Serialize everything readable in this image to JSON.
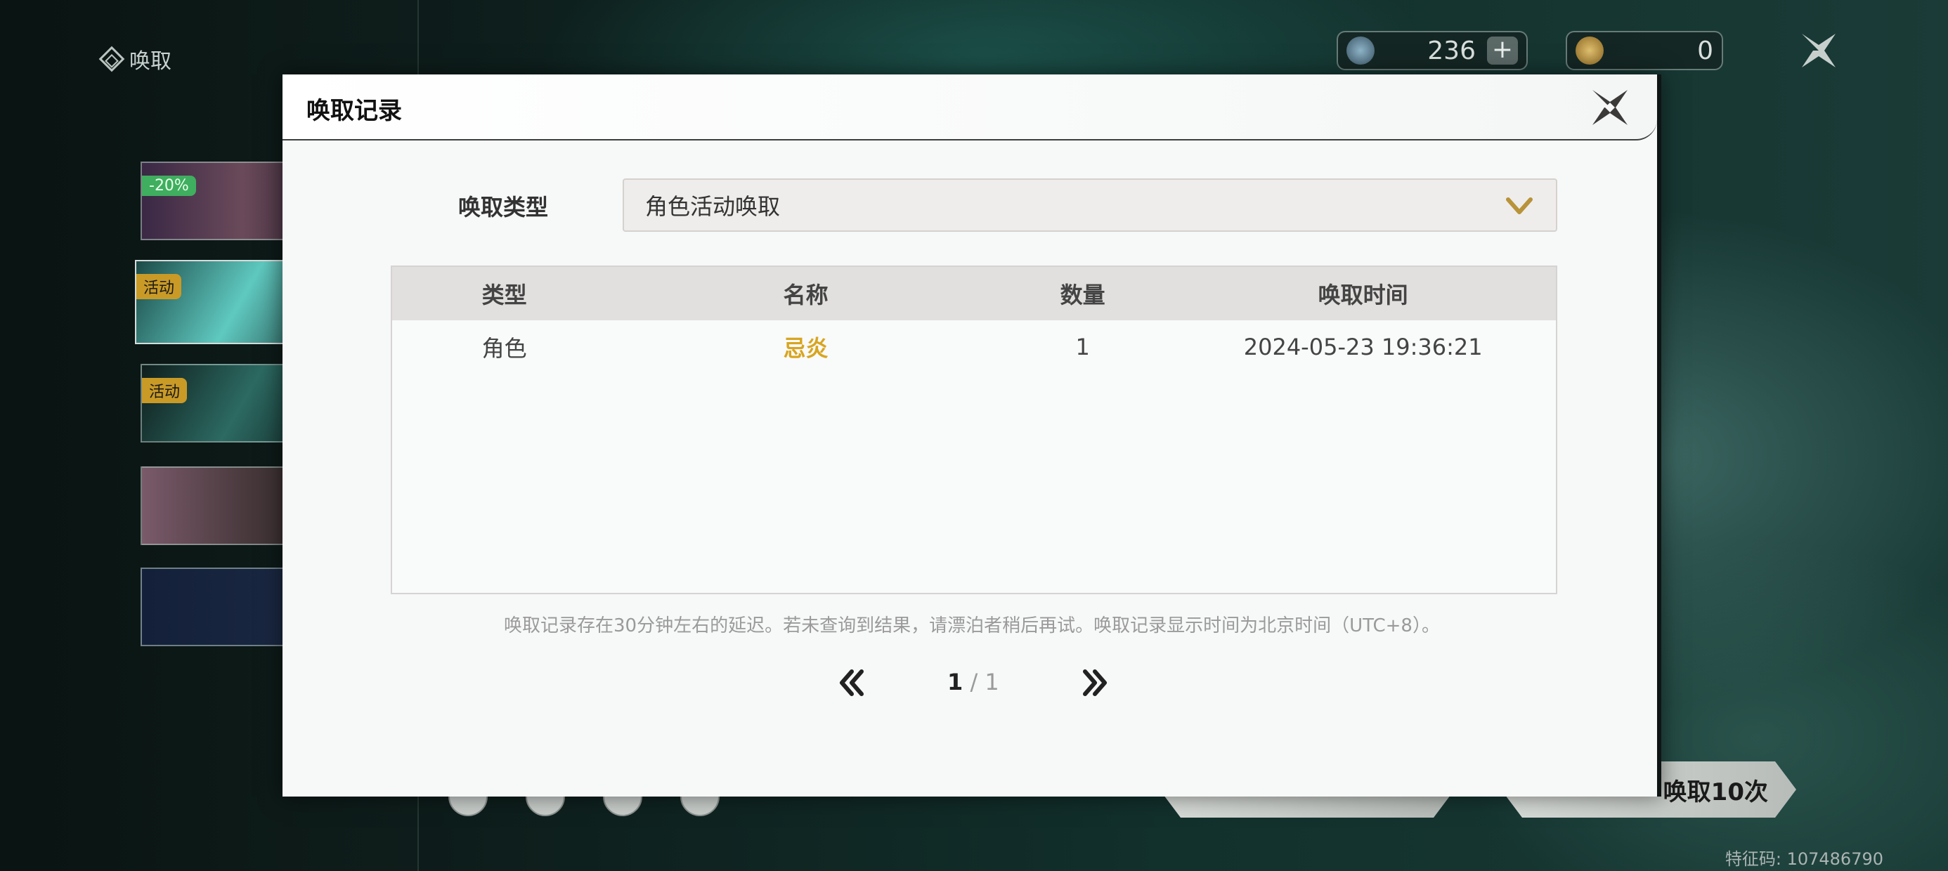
{
  "background": {
    "summon_title": "唤取",
    "resources": [
      {
        "name": "star-currency",
        "value": "236"
      },
      {
        "name": "coin-currency",
        "value": "0"
      }
    ],
    "banner_tags": [
      "-20%",
      "活动",
      "活动"
    ],
    "bottom_button": "唤取10次",
    "feature_code": "特征码: 107486790"
  },
  "modal": {
    "title": "唤取记录",
    "type_label": "唤取类型",
    "type_selected": "角色活动唤取",
    "table": {
      "headers": [
        "类型",
        "名称",
        "数量",
        "唤取时间"
      ],
      "rows": [
        {
          "type": "角色",
          "name": "忌炎",
          "count": "1",
          "time": "2024-05-23 19:36:21"
        }
      ]
    },
    "note": "唤取记录存在30分钟左右的延迟。若未查询到结果，请漂泊者稍后再试。唤取记录显示时间为北京时间（UTC+8）。",
    "pagination": {
      "current": "1",
      "separator": " / ",
      "total": "1"
    }
  },
  "colors": {
    "accent_gold": "#d8a51f",
    "chevron_gold": "#b8933a"
  }
}
